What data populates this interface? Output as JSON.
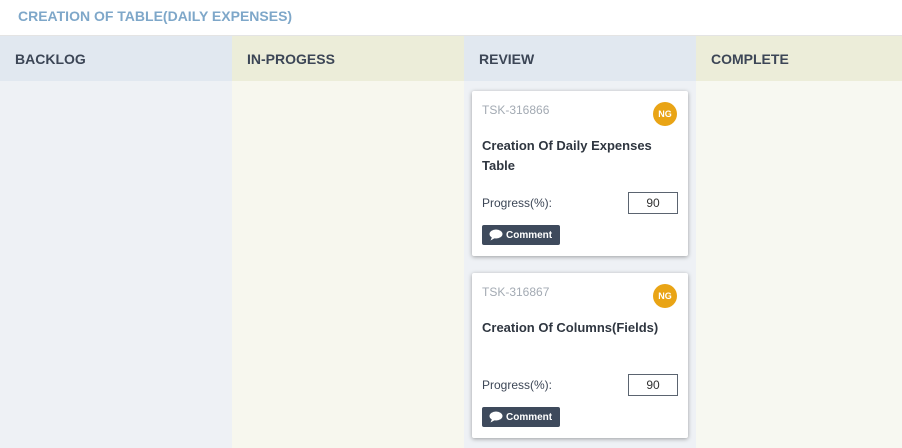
{
  "board": {
    "title": "CREATION OF TABLE(DAILY EXPENSES)"
  },
  "columns": [
    {
      "label": "BACKLOG"
    },
    {
      "label": "IN-PROGESS"
    },
    {
      "label": "REVIEW"
    },
    {
      "label": "COMPLETE"
    }
  ],
  "cards": [
    {
      "id": "TSK-316866",
      "avatar": "NG",
      "title": "Creation Of Daily Expenses Table",
      "progress_label": "Progress(%):",
      "progress_value": "90",
      "comment_label": "Comment"
    },
    {
      "id": "TSK-316867",
      "avatar": "NG",
      "title": "Creation Of Columns(Fields)",
      "progress_label": "Progress(%):",
      "progress_value": "90",
      "comment_label": "Comment"
    }
  ],
  "colors": {
    "header_text": "#7ea7c9",
    "avatar_bg": "#e9a415",
    "button_bg": "#3e4a5c"
  },
  "icons": {
    "comment": "comment-icon"
  }
}
